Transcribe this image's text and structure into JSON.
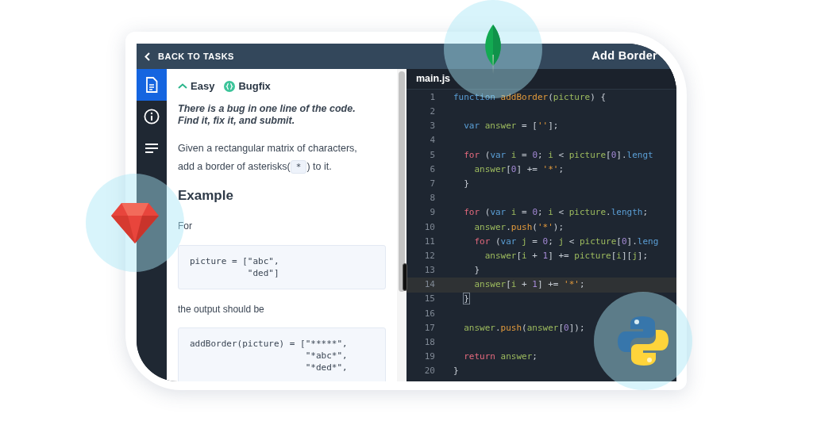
{
  "header": {
    "back_label": "BACK TO TASKS",
    "title": "Add Border"
  },
  "sidebar": {
    "items": [
      {
        "kind": "document",
        "selected": true
      },
      {
        "kind": "info",
        "selected": false
      },
      {
        "kind": "list",
        "selected": false
      }
    ]
  },
  "task": {
    "difficulty": "Easy",
    "type": "Bugfix",
    "instruction": [
      "There is a bug in one line of the code.",
      "Find it, fix it, and submit."
    ],
    "description": {
      "before": "Given a rectangular matrix of characters, add a border of asterisks(",
      "code": "*",
      "after": ") to it."
    },
    "example_heading": "Example",
    "for_label": "For",
    "input_code": [
      "picture = [\"abc\",",
      "           \"ded\"]"
    ],
    "output_label": "the output should be",
    "output_code": [
      "addBorder(picture) = [\"*****\",",
      "                      \"*abc*\",",
      "                      \"*ded*\","
    ]
  },
  "editor": {
    "tab": "main.js",
    "lines": [
      {
        "number": "1",
        "highlighted": false,
        "tokens": [
          {
            "kind": "keyword",
            "text": "function"
          },
          {
            "kind": "call",
            "text": " addBorder"
          },
          {
            "kind": "plain",
            "text": "("
          },
          {
            "kind": "name",
            "text": "picture"
          },
          {
            "kind": "plain",
            "text": ") {"
          }
        ]
      },
      {
        "number": "2",
        "highlighted": false
      },
      {
        "number": "3",
        "highlighted": false,
        "tokens": [
          {
            "kind": "keyword",
            "text": "  var"
          },
          {
            "kind": "name",
            "text": " answer"
          },
          {
            "kind": "plain",
            "text": " = ["
          },
          {
            "kind": "string",
            "text": "''"
          },
          {
            "kind": "plain",
            "text": "];"
          }
        ]
      },
      {
        "number": "4",
        "highlighted": false
      },
      {
        "number": "5",
        "highlighted": false,
        "tokens": [
          {
            "kind": "control",
            "text": "  for"
          },
          {
            "kind": "plain",
            "text": " ("
          },
          {
            "kind": "keyword",
            "text": "var"
          },
          {
            "kind": "name",
            "text": " i"
          },
          {
            "kind": "plain",
            "text": " = "
          },
          {
            "kind": "number",
            "text": "0"
          },
          {
            "kind": "plain",
            "text": "; "
          },
          {
            "kind": "name",
            "text": "i"
          },
          {
            "kind": "plain",
            "text": " < "
          },
          {
            "kind": "name",
            "text": "picture"
          },
          {
            "kind": "plain",
            "text": "["
          },
          {
            "kind": "number",
            "text": "0"
          },
          {
            "kind": "plain",
            "text": "]."
          },
          {
            "kind": "property",
            "text": "lengt"
          }
        ]
      },
      {
        "number": "6",
        "highlighted": false,
        "tokens": [
          {
            "kind": "name",
            "text": "    answer"
          },
          {
            "kind": "plain",
            "text": "["
          },
          {
            "kind": "number",
            "text": "0"
          },
          {
            "kind": "plain",
            "text": "] += "
          },
          {
            "kind": "string",
            "text": "'*'"
          },
          {
            "kind": "plain",
            "text": ";"
          }
        ]
      },
      {
        "number": "7",
        "highlighted": false,
        "tokens": [
          {
            "kind": "plain",
            "text": "  }"
          }
        ]
      },
      {
        "number": "8",
        "highlighted": false
      },
      {
        "number": "9",
        "highlighted": false,
        "tokens": [
          {
            "kind": "control",
            "text": "  for"
          },
          {
            "kind": "plain",
            "text": " ("
          },
          {
            "kind": "keyword",
            "text": "var"
          },
          {
            "kind": "name",
            "text": " i"
          },
          {
            "kind": "plain",
            "text": " = "
          },
          {
            "kind": "number",
            "text": "0"
          },
          {
            "kind": "plain",
            "text": "; "
          },
          {
            "kind": "name",
            "text": "i"
          },
          {
            "kind": "plain",
            "text": " < "
          },
          {
            "kind": "name",
            "text": "picture"
          },
          {
            "kind": "plain",
            "text": "."
          },
          {
            "kind": "property",
            "text": "length"
          },
          {
            "kind": "plain",
            "text": ";"
          }
        ]
      },
      {
        "number": "10",
        "highlighted": false,
        "tokens": [
          {
            "kind": "name",
            "text": "    answer"
          },
          {
            "kind": "plain",
            "text": "."
          },
          {
            "kind": "call",
            "text": "push"
          },
          {
            "kind": "plain",
            "text": "("
          },
          {
            "kind": "string",
            "text": "'*'"
          },
          {
            "kind": "plain",
            "text": ");"
          }
        ]
      },
      {
        "number": "11",
        "highlighted": false,
        "tokens": [
          {
            "kind": "control",
            "text": "    for"
          },
          {
            "kind": "plain",
            "text": " ("
          },
          {
            "kind": "keyword",
            "text": "var"
          },
          {
            "kind": "name",
            "text": " j"
          },
          {
            "kind": "plain",
            "text": " = "
          },
          {
            "kind": "number",
            "text": "0"
          },
          {
            "kind": "plain",
            "text": "; "
          },
          {
            "kind": "name",
            "text": "j"
          },
          {
            "kind": "plain",
            "text": " < "
          },
          {
            "kind": "name",
            "text": "picture"
          },
          {
            "kind": "plain",
            "text": "["
          },
          {
            "kind": "number",
            "text": "0"
          },
          {
            "kind": "plain",
            "text": "]."
          },
          {
            "kind": "property",
            "text": "leng"
          }
        ]
      },
      {
        "number": "12",
        "highlighted": false,
        "tokens": [
          {
            "kind": "name",
            "text": "      answer"
          },
          {
            "kind": "plain",
            "text": "["
          },
          {
            "kind": "name",
            "text": "i"
          },
          {
            "kind": "plain",
            "text": " + "
          },
          {
            "kind": "number",
            "text": "1"
          },
          {
            "kind": "plain",
            "text": "] += "
          },
          {
            "kind": "name",
            "text": "picture"
          },
          {
            "kind": "plain",
            "text": "["
          },
          {
            "kind": "name",
            "text": "i"
          },
          {
            "kind": "plain",
            "text": "]["
          },
          {
            "kind": "name",
            "text": "j"
          },
          {
            "kind": "plain",
            "text": "];"
          }
        ]
      },
      {
        "number": "13",
        "highlighted": false,
        "tokens": [
          {
            "kind": "plain",
            "text": "    }"
          }
        ]
      },
      {
        "number": "14",
        "highlighted": true,
        "tokens": [
          {
            "kind": "name",
            "text": "    answer"
          },
          {
            "kind": "plain",
            "text": "["
          },
          {
            "kind": "name",
            "text": "i"
          },
          {
            "kind": "plain",
            "text": " + "
          },
          {
            "kind": "number",
            "text": "1"
          },
          {
            "kind": "plain",
            "text": "] += "
          },
          {
            "kind": "string",
            "text": "'*'"
          },
          {
            "kind": "plain",
            "text": ";"
          }
        ]
      },
      {
        "number": "15",
        "highlighted": false,
        "tokens": [
          {
            "kind": "match",
            "text": "  }"
          }
        ]
      },
      {
        "number": "16",
        "highlighted": false
      },
      {
        "number": "17",
        "highlighted": false,
        "tokens": [
          {
            "kind": "name",
            "text": "  answer"
          },
          {
            "kind": "plain",
            "text": "."
          },
          {
            "kind": "call",
            "text": "push"
          },
          {
            "kind": "plain",
            "text": "("
          },
          {
            "kind": "name",
            "text": "answer"
          },
          {
            "kind": "plain",
            "text": "["
          },
          {
            "kind": "number",
            "text": "0"
          },
          {
            "kind": "plain",
            "text": "]);"
          }
        ]
      },
      {
        "number": "18",
        "highlighted": false
      },
      {
        "number": "19",
        "highlighted": false,
        "tokens": [
          {
            "kind": "control",
            "text": "  return"
          },
          {
            "kind": "name",
            "text": " answer"
          },
          {
            "kind": "plain",
            "text": ";"
          }
        ]
      },
      {
        "number": "20",
        "highlighted": false,
        "tokens": [
          {
            "kind": "plain",
            "text": "}"
          }
        ]
      }
    ]
  }
}
